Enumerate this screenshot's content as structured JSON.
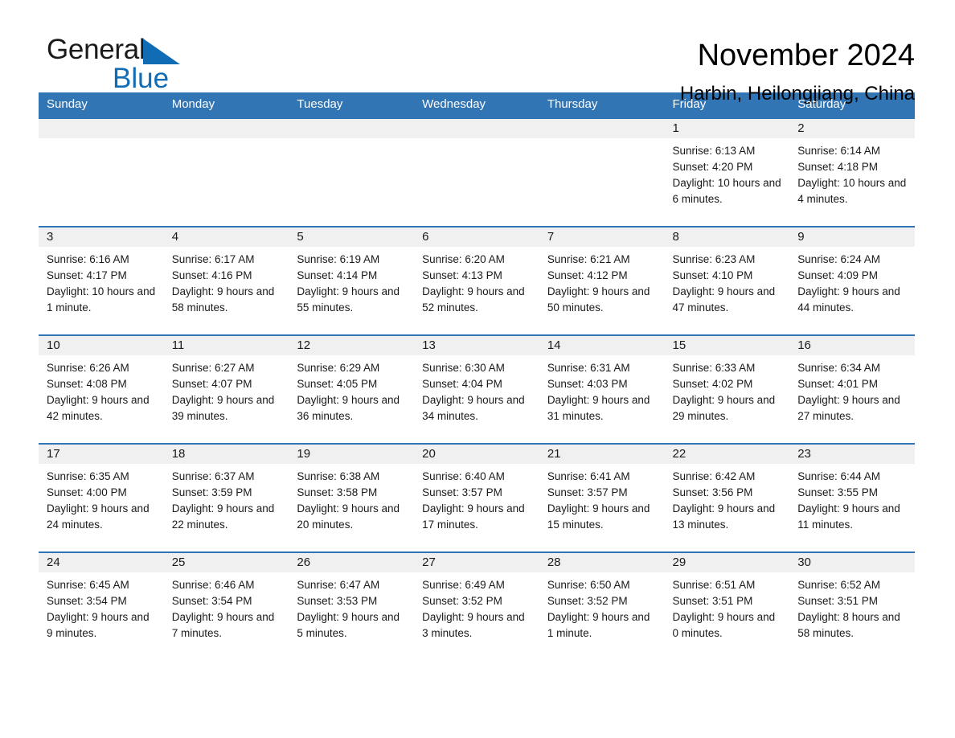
{
  "brand": {
    "name_part1": "General",
    "name_part2": "Blue",
    "triangle_icon": "triangle-icon",
    "accent_color": "#0f6cb5"
  },
  "header": {
    "title": "November 2024",
    "subtitle": "Harbin, Heilongjiang, China"
  },
  "theme": {
    "header_blue": "#3275b5",
    "daynum_strip": "#f0f0f0",
    "text": "#1a1a1a"
  },
  "weekday_headers": [
    "Sunday",
    "Monday",
    "Tuesday",
    "Wednesday",
    "Thursday",
    "Friday",
    "Saturday"
  ],
  "weeks": [
    [
      {
        "day": "",
        "sunrise": "",
        "sunset": "",
        "daylight": ""
      },
      {
        "day": "",
        "sunrise": "",
        "sunset": "",
        "daylight": ""
      },
      {
        "day": "",
        "sunrise": "",
        "sunset": "",
        "daylight": ""
      },
      {
        "day": "",
        "sunrise": "",
        "sunset": "",
        "daylight": ""
      },
      {
        "day": "",
        "sunrise": "",
        "sunset": "",
        "daylight": ""
      },
      {
        "day": "1",
        "sunrise": "Sunrise: 6:13 AM",
        "sunset": "Sunset: 4:20 PM",
        "daylight": "Daylight: 10 hours and 6 minutes."
      },
      {
        "day": "2",
        "sunrise": "Sunrise: 6:14 AM",
        "sunset": "Sunset: 4:18 PM",
        "daylight": "Daylight: 10 hours and 4 minutes."
      }
    ],
    [
      {
        "day": "3",
        "sunrise": "Sunrise: 6:16 AM",
        "sunset": "Sunset: 4:17 PM",
        "daylight": "Daylight: 10 hours and 1 minute."
      },
      {
        "day": "4",
        "sunrise": "Sunrise: 6:17 AM",
        "sunset": "Sunset: 4:16 PM",
        "daylight": "Daylight: 9 hours and 58 minutes."
      },
      {
        "day": "5",
        "sunrise": "Sunrise: 6:19 AM",
        "sunset": "Sunset: 4:14 PM",
        "daylight": "Daylight: 9 hours and 55 minutes."
      },
      {
        "day": "6",
        "sunrise": "Sunrise: 6:20 AM",
        "sunset": "Sunset: 4:13 PM",
        "daylight": "Daylight: 9 hours and 52 minutes."
      },
      {
        "day": "7",
        "sunrise": "Sunrise: 6:21 AM",
        "sunset": "Sunset: 4:12 PM",
        "daylight": "Daylight: 9 hours and 50 minutes."
      },
      {
        "day": "8",
        "sunrise": "Sunrise: 6:23 AM",
        "sunset": "Sunset: 4:10 PM",
        "daylight": "Daylight: 9 hours and 47 minutes."
      },
      {
        "day": "9",
        "sunrise": "Sunrise: 6:24 AM",
        "sunset": "Sunset: 4:09 PM",
        "daylight": "Daylight: 9 hours and 44 minutes."
      }
    ],
    [
      {
        "day": "10",
        "sunrise": "Sunrise: 6:26 AM",
        "sunset": "Sunset: 4:08 PM",
        "daylight": "Daylight: 9 hours and 42 minutes."
      },
      {
        "day": "11",
        "sunrise": "Sunrise: 6:27 AM",
        "sunset": "Sunset: 4:07 PM",
        "daylight": "Daylight: 9 hours and 39 minutes."
      },
      {
        "day": "12",
        "sunrise": "Sunrise: 6:29 AM",
        "sunset": "Sunset: 4:05 PM",
        "daylight": "Daylight: 9 hours and 36 minutes."
      },
      {
        "day": "13",
        "sunrise": "Sunrise: 6:30 AM",
        "sunset": "Sunset: 4:04 PM",
        "daylight": "Daylight: 9 hours and 34 minutes."
      },
      {
        "day": "14",
        "sunrise": "Sunrise: 6:31 AM",
        "sunset": "Sunset: 4:03 PM",
        "daylight": "Daylight: 9 hours and 31 minutes."
      },
      {
        "day": "15",
        "sunrise": "Sunrise: 6:33 AM",
        "sunset": "Sunset: 4:02 PM",
        "daylight": "Daylight: 9 hours and 29 minutes."
      },
      {
        "day": "16",
        "sunrise": "Sunrise: 6:34 AM",
        "sunset": "Sunset: 4:01 PM",
        "daylight": "Daylight: 9 hours and 27 minutes."
      }
    ],
    [
      {
        "day": "17",
        "sunrise": "Sunrise: 6:35 AM",
        "sunset": "Sunset: 4:00 PM",
        "daylight": "Daylight: 9 hours and 24 minutes."
      },
      {
        "day": "18",
        "sunrise": "Sunrise: 6:37 AM",
        "sunset": "Sunset: 3:59 PM",
        "daylight": "Daylight: 9 hours and 22 minutes."
      },
      {
        "day": "19",
        "sunrise": "Sunrise: 6:38 AM",
        "sunset": "Sunset: 3:58 PM",
        "daylight": "Daylight: 9 hours and 20 minutes."
      },
      {
        "day": "20",
        "sunrise": "Sunrise: 6:40 AM",
        "sunset": "Sunset: 3:57 PM",
        "daylight": "Daylight: 9 hours and 17 minutes."
      },
      {
        "day": "21",
        "sunrise": "Sunrise: 6:41 AM",
        "sunset": "Sunset: 3:57 PM",
        "daylight": "Daylight: 9 hours and 15 minutes."
      },
      {
        "day": "22",
        "sunrise": "Sunrise: 6:42 AM",
        "sunset": "Sunset: 3:56 PM",
        "daylight": "Daylight: 9 hours and 13 minutes."
      },
      {
        "day": "23",
        "sunrise": "Sunrise: 6:44 AM",
        "sunset": "Sunset: 3:55 PM",
        "daylight": "Daylight: 9 hours and 11 minutes."
      }
    ],
    [
      {
        "day": "24",
        "sunrise": "Sunrise: 6:45 AM",
        "sunset": "Sunset: 3:54 PM",
        "daylight": "Daylight: 9 hours and 9 minutes."
      },
      {
        "day": "25",
        "sunrise": "Sunrise: 6:46 AM",
        "sunset": "Sunset: 3:54 PM",
        "daylight": "Daylight: 9 hours and 7 minutes."
      },
      {
        "day": "26",
        "sunrise": "Sunrise: 6:47 AM",
        "sunset": "Sunset: 3:53 PM",
        "daylight": "Daylight: 9 hours and 5 minutes."
      },
      {
        "day": "27",
        "sunrise": "Sunrise: 6:49 AM",
        "sunset": "Sunset: 3:52 PM",
        "daylight": "Daylight: 9 hours and 3 minutes."
      },
      {
        "day": "28",
        "sunrise": "Sunrise: 6:50 AM",
        "sunset": "Sunset: 3:52 PM",
        "daylight": "Daylight: 9 hours and 1 minute."
      },
      {
        "day": "29",
        "sunrise": "Sunrise: 6:51 AM",
        "sunset": "Sunset: 3:51 PM",
        "daylight": "Daylight: 9 hours and 0 minutes."
      },
      {
        "day": "30",
        "sunrise": "Sunrise: 6:52 AM",
        "sunset": "Sunset: 3:51 PM",
        "daylight": "Daylight: 8 hours and 58 minutes."
      }
    ]
  ]
}
